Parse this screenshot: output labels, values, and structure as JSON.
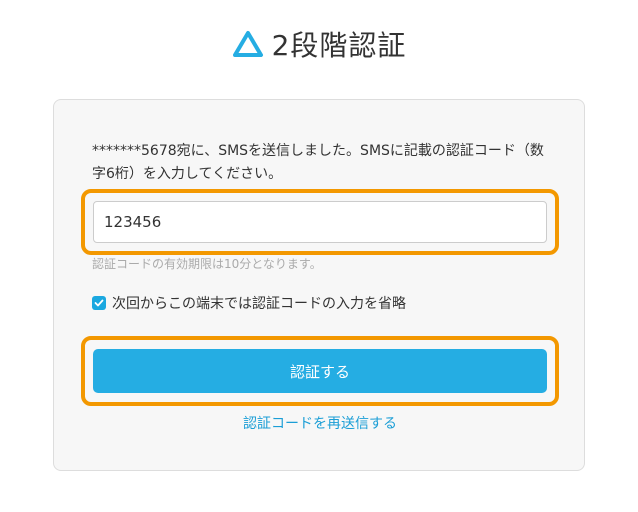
{
  "header": {
    "logo_icon": "triangle-logo-icon",
    "title": "2段階認証"
  },
  "form": {
    "message": "*******5678宛に、SMSを送信しました。SMSに記載の認証コード（数字6桁）を入力してください。",
    "code_value": "123456",
    "code_placeholder": "",
    "hint": "認証コードの有効期限は10分となります。",
    "remember_label": "次回からこの端末では認証コードの入力を省略",
    "remember_checked": true,
    "submit_label": "認証する",
    "resend_label": "認証コードを再送信する"
  },
  "colors": {
    "accent": "#25ade3",
    "highlight": "#f39800",
    "link": "#1b9ed6"
  }
}
